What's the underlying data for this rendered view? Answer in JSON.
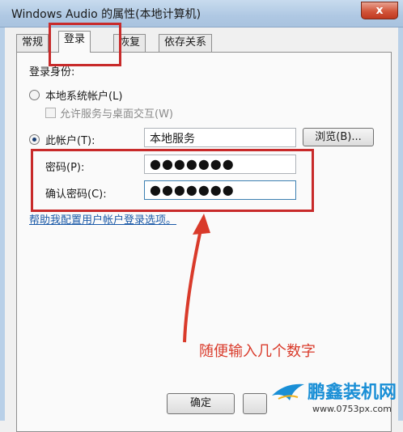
{
  "window": {
    "title": "Windows Audio 的属性(本地计算机)",
    "close_label": "x"
  },
  "tabs": [
    {
      "label": "常规",
      "active": false
    },
    {
      "label": "登录",
      "active": true
    },
    {
      "label": "恢复",
      "active": false
    },
    {
      "label": "依存关系",
      "active": false
    }
  ],
  "logon": {
    "section_label": "登录身份:",
    "local_system_label": "本地系统帐户(L)",
    "allow_desktop_label": "允许服务与桌面交互(W)",
    "this_account_label": "此帐户(T):",
    "account_value": "本地服务",
    "browse_label": "浏览(B)...",
    "password_label": "密码(P):",
    "password_value": "●●●●●●●",
    "confirm_label": "确认密码(C):",
    "confirm_value": "●●●●●●●",
    "help_link": "帮助我配置用户帐户登录选项。"
  },
  "annotation": {
    "text": "随便输入几个数字",
    "color": "#d93a2a"
  },
  "footer": {
    "ok_label": "确定"
  },
  "watermark": {
    "name": "鹏鑫装机网",
    "url": "www.0753px.com",
    "icon": "bird-logo-icon"
  },
  "colors": {
    "highlight_red": "#c82a2a",
    "title_bar": "#afc8e3",
    "link_blue": "#1b5aa8"
  }
}
